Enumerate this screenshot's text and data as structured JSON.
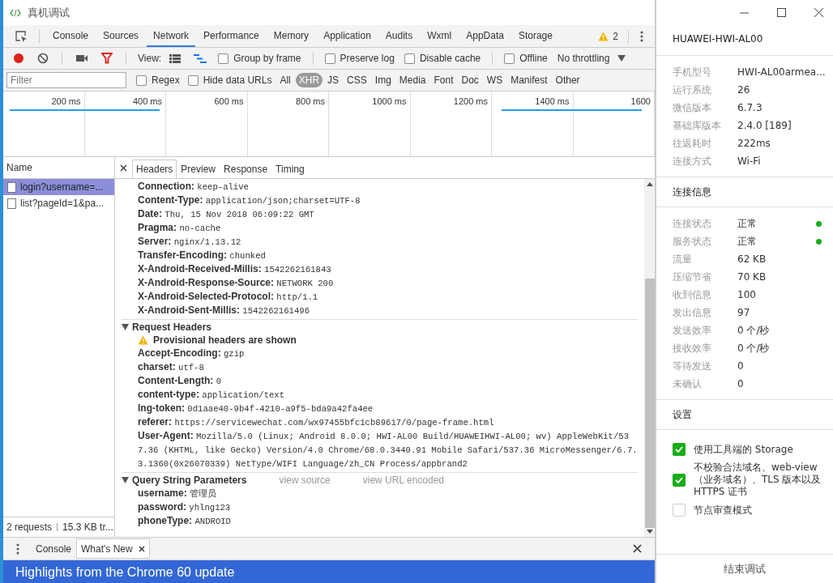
{
  "window": {
    "title": "真机调试"
  },
  "tabs": [
    {
      "label": "Console",
      "selected": false
    },
    {
      "label": "Sources",
      "selected": false
    },
    {
      "label": "Network",
      "selected": true
    },
    {
      "label": "Performance",
      "selected": false
    },
    {
      "label": "Memory",
      "selected": false
    },
    {
      "label": "Application",
      "selected": false
    },
    {
      "label": "Audits",
      "selected": false
    },
    {
      "label": "Wxml",
      "selected": false
    },
    {
      "label": "AppData",
      "selected": false
    },
    {
      "label": "Storage",
      "selected": false
    }
  ],
  "warning_count": "2",
  "toolbar": {
    "recording": true,
    "view_label": "View:",
    "options": [
      {
        "label": "Group by frame",
        "checked": false
      },
      {
        "label": "Preserve log",
        "checked": false
      },
      {
        "label": "Disable cache",
        "checked": false
      },
      {
        "label": "Offline",
        "checked": false
      }
    ],
    "throttling": "No throttling"
  },
  "filter": {
    "placeholder": "Filter",
    "options": [
      {
        "label": "Regex",
        "checked": false
      },
      {
        "label": "Hide data URLs",
        "checked": false
      }
    ],
    "types": [
      {
        "label": "All",
        "selected": false
      },
      {
        "label": "XHR",
        "selected": true
      },
      {
        "label": "JS",
        "selected": false
      },
      {
        "label": "CSS",
        "selected": false
      },
      {
        "label": "Img",
        "selected": false
      },
      {
        "label": "Media",
        "selected": false
      },
      {
        "label": "Font",
        "selected": false
      },
      {
        "label": "Doc",
        "selected": false
      },
      {
        "label": "WS",
        "selected": false
      },
      {
        "label": "Manifest",
        "selected": false
      },
      {
        "label": "Other",
        "selected": false
      }
    ]
  },
  "timeline": {
    "ticks": [
      "200 ms",
      "400 ms",
      "600 ms",
      "800 ms",
      "1000 ms",
      "1200 ms",
      "1400 ms",
      "1600"
    ]
  },
  "requests": {
    "header": "Name",
    "items": [
      {
        "name": "login?username=...",
        "selected": true
      },
      {
        "name": "list?pageId=1&pa...",
        "selected": false
      }
    ],
    "summary": [
      "2 requests",
      "15.3 KB tr..."
    ]
  },
  "detail_tabs": [
    {
      "label": "Headers",
      "selected": true
    },
    {
      "label": "Preview",
      "selected": false
    },
    {
      "label": "Response",
      "selected": false
    },
    {
      "label": "Timing",
      "selected": false
    }
  ],
  "response_headers": [
    {
      "name": "Connection:",
      "value": "keep-alive"
    },
    {
      "name": "Content-Type:",
      "value": "application/json;charset=UTF-8"
    },
    {
      "name": "Date:",
      "value": "Thu, 15 Nov 2018 06:09:22 GMT"
    },
    {
      "name": "Pragma:",
      "value": "no-cache"
    },
    {
      "name": "Server:",
      "value": "nginx/1.13.12"
    },
    {
      "name": "Transfer-Encoding:",
      "value": "chunked"
    },
    {
      "name": "X-Android-Received-Millis:",
      "value": "1542262161843"
    },
    {
      "name": "X-Android-Response-Source:",
      "value": "NETWORK 200"
    },
    {
      "name": "X-Android-Selected-Protocol:",
      "value": "http/1.1"
    },
    {
      "name": "X-Android-Sent-Millis:",
      "value": "1542262161496"
    }
  ],
  "request_headers": {
    "title": "Request Headers",
    "expanded": true,
    "warning": "Provisional headers are shown",
    "items": [
      {
        "name": "Accept-Encoding:",
        "value": "gzip"
      },
      {
        "name": "charset:",
        "value": "utf-8"
      },
      {
        "name": "Content-Length:",
        "value": "0"
      },
      {
        "name": "content-type:",
        "value": "application/text"
      },
      {
        "name": "lng-token:",
        "value": "0d1aae40-9b4f-4210-a9f5-bda9a42fa4ee"
      },
      {
        "name": "referer:",
        "value": "https://servicewechat.com/wx97455bfc1cb89617/0/page-frame.html"
      },
      {
        "name": "User-Agent:",
        "value": "Mozilla/5.0 (Linux; Android 8.0.0; HWI-AL00 Build/HUAWEIHWI-AL00; wv) AppleWebKit/537.36 (KHTML, like Gecko) Version/4.0 Chrome/68.0.3440.91 Mobile Safari/537.36 MicroMessenger/6.7.3.1360(0x26070339) NetType/WIFI Language/zh_CN Process/appbrand2"
      }
    ]
  },
  "query_params": {
    "title": "Query String Parameters",
    "expanded": true,
    "links": [
      "view source",
      "view URL encoded"
    ],
    "items": [
      {
        "name": "username:",
        "value": "管理员"
      },
      {
        "name": "password:",
        "value": "yhlng123"
      },
      {
        "name": "phoneType:",
        "value": "ANDROID"
      }
    ]
  },
  "drawer": {
    "tabs": [
      {
        "label": "Console",
        "selected": false
      },
      {
        "label": "What's New",
        "selected": true
      }
    ],
    "banner": "Highlights from the Chrome 60 update"
  },
  "device": {
    "name": "HUAWEI-HWI-AL00",
    "info": [
      {
        "label": "手机型号",
        "value": "HWI-AL00armea..."
      },
      {
        "label": "运行系统",
        "value": "26"
      },
      {
        "label": "微信版本",
        "value": "6.7.3"
      },
      {
        "label": "基础库版本",
        "value": "2.4.0 [189]"
      },
      {
        "label": "往返耗时",
        "value": "222ms"
      },
      {
        "label": "连接方式",
        "value": "Wi-Fi"
      }
    ],
    "connection": {
      "title": "连接信息",
      "items": [
        {
          "label": "连接状态",
          "value": "正常",
          "color": "#1aad19"
        },
        {
          "label": "服务状态",
          "value": "正常",
          "color": "#1aad19"
        },
        {
          "label": "流量",
          "value": "62 KB"
        },
        {
          "label": "压缩节省",
          "value": "70 KB"
        },
        {
          "label": "收到信息",
          "value": "100"
        },
        {
          "label": "发出信息",
          "value": "97"
        },
        {
          "label": "发送效率",
          "value": "0 个/秒"
        },
        {
          "label": "接收效率",
          "value": "0 个/秒"
        },
        {
          "label": "等待发送",
          "value": "0"
        },
        {
          "label": "未确认",
          "value": "0"
        }
      ]
    },
    "settings": {
      "title": "设置",
      "items": [
        {
          "label": "使用工具端的 Storage",
          "checked": true
        },
        {
          "label": "不校验合法域名、web-view（业务域名）、TLS 版本以及 HTTPS 证书",
          "checked": true
        },
        {
          "label": "节点审查模式",
          "checked": false
        }
      ]
    },
    "end_button": "结束调试"
  }
}
